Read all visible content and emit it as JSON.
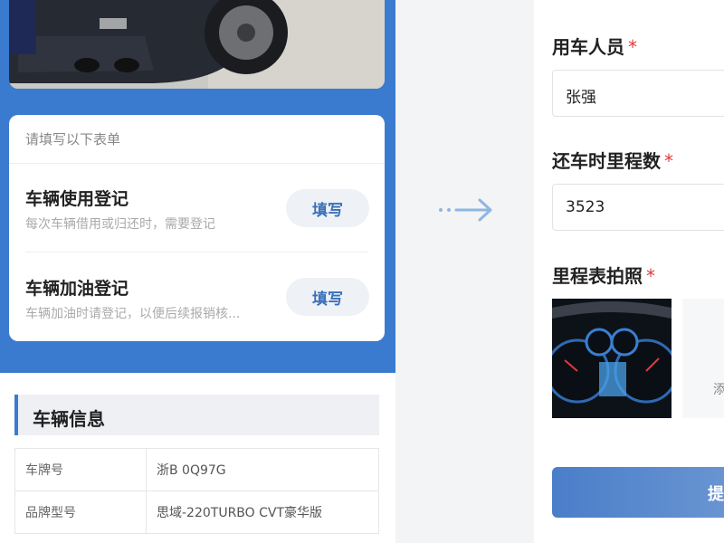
{
  "left": {
    "card": {
      "header": "请填写以下表单",
      "rows": [
        {
          "title": "车辆使用登记",
          "subtitle": "每次车辆借用或归还时，需要登记",
          "button": "填写"
        },
        {
          "title": "车辆加油登记",
          "subtitle": "车辆加油时请登记，以便后续报销核...",
          "button": "填写"
        }
      ]
    },
    "info": {
      "title": "车辆信息",
      "rows": [
        {
          "key": "车牌号",
          "value": "浙B 0Q97G"
        },
        {
          "key": "品牌型号",
          "value": "思域-220TURBO CVT豪华版"
        }
      ]
    }
  },
  "right": {
    "fields": [
      {
        "label": "用车人员",
        "required": "*",
        "value": "张强"
      },
      {
        "label": "还车时里程数",
        "required": "*",
        "value": "3523"
      }
    ],
    "photo_label": "里程表拍照",
    "photo_required": "*",
    "add_photo_text": "添",
    "submit_label": "提"
  },
  "colors": {
    "brand_blue": "#3a7bd0",
    "required_red": "#e03a3a",
    "arrow": "#8fb6e3"
  }
}
